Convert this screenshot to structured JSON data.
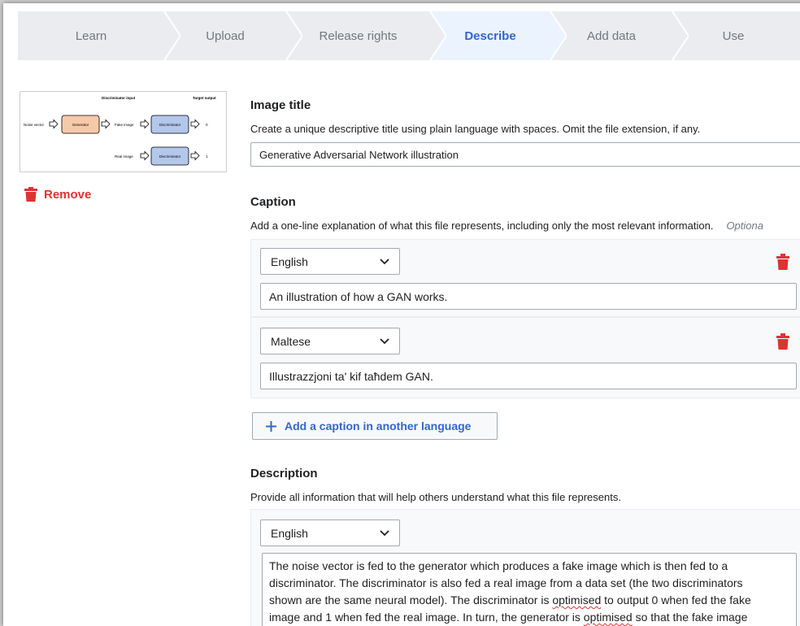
{
  "steps": [
    "Learn",
    "Upload",
    "Release rights",
    "Describe",
    "Add data",
    "Use"
  ],
  "thumbnail": {
    "labels": {
      "discriminator_input": "Discriminator input",
      "target_output": "Target output",
      "noise_vector": "Noise vector",
      "generator": "Generator",
      "fake_image": "Fake image",
      "discriminator": "Discriminator",
      "real_image": "Real image",
      "out0": "0",
      "out1": "1"
    }
  },
  "remove_label": "Remove",
  "title_field": {
    "label": "Image title",
    "help": "Create a unique descriptive title using plain language with spaces. Omit the file extension, if any.",
    "value": "Generative Adversarial Network illustration"
  },
  "caption": {
    "label": "Caption",
    "help": "Add a one-line explanation of what this file represents, including only the most relevant information.",
    "optional": "Optiona",
    "entries": [
      {
        "language": "English",
        "text": "An illustration of how a GAN works."
      },
      {
        "language": "Maltese",
        "text": "Illustrazzjoni ta' kif taħdem GAN."
      }
    ],
    "add_label": "Add a caption in another language"
  },
  "description": {
    "label": "Description",
    "help": "Provide all information that will help others understand what this file represents.",
    "language": "English",
    "lines": [
      "The noise vector is fed to the generator which produces a fake image which is then fed to a",
      "discriminator. The discriminator is also fed a real image from a data set (the two discriminators",
      "shown are the same neural model). The discriminator is ",
      "optimised",
      " to output 0 when fed the fake",
      "image and 1 when fed the real image. In turn, the generator is ",
      "optimised",
      " so that the fake image"
    ]
  },
  "colors": {
    "accent": "#3366cc",
    "destructive": "#d33333",
    "generator": "#f6c9a8",
    "discriminator": "#b3c7ea"
  }
}
